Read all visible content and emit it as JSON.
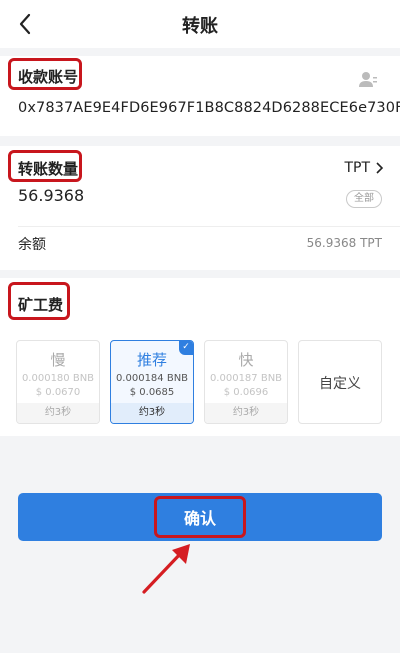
{
  "header": {
    "title": "转账"
  },
  "recipient": {
    "label": "收款账号",
    "address": "0x7837AE9E4FD6E967F1B8C8824D6288ECE6e730F9"
  },
  "amount": {
    "label": "转账数量",
    "token": "TPT",
    "value": "56.9368",
    "all_label": "全部",
    "balance_label": "余额",
    "balance_value": "56.9368 TPT"
  },
  "fee": {
    "label": "矿工费",
    "options": [
      {
        "name": "慢",
        "bnb": "0.000180 BNB",
        "usd": "$ 0.0670",
        "time": "约3秒"
      },
      {
        "name": "推荐",
        "bnb": "0.000184 BNB",
        "usd": "$ 0.0685",
        "time": "约3秒"
      },
      {
        "name": "快",
        "bnb": "0.000187 BNB",
        "usd": "$ 0.0696",
        "time": "约3秒"
      },
      {
        "name": "自定义"
      }
    ],
    "selected_index": 1
  },
  "confirm_label": "确认",
  "colors": {
    "accent": "#2f7fe0",
    "highlight": "#c8161d",
    "background": "#f3f4f6"
  },
  "icons": [
    "back-chevron-icon",
    "contacts-icon",
    "chevron-right-icon",
    "check-icon",
    "pointer-arrow-icon"
  ]
}
